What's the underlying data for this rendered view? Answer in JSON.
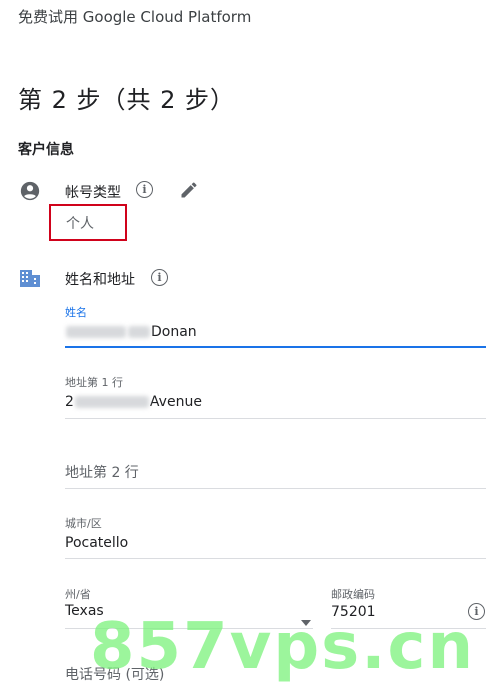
{
  "header": {
    "title": "免费试用 Google Cloud Platform"
  },
  "step": {
    "title": "第 2 步（共 2 步）"
  },
  "customer_info": {
    "title": "客户信息"
  },
  "account_type": {
    "label": "帐号类型",
    "value": "个人",
    "info_icon": "info-icon",
    "edit_icon": "pencil-icon"
  },
  "name_address": {
    "title": "姓名和地址",
    "info_icon": "info-icon",
    "section_icon": "building-icon"
  },
  "fields": {
    "name": {
      "label": "姓名",
      "value_suffix": "onan",
      "value_prefix_visible": "D"
    },
    "address1": {
      "label": "地址第 1 行",
      "value_prefix_visible": "2",
      "value_suffix": "Avenue"
    },
    "address2": {
      "placeholder": "地址第 2 行"
    },
    "city": {
      "label": "城市/区",
      "value": "Pocatello"
    },
    "state": {
      "label": "州/省",
      "value": "Texas",
      "dropdown_icon": "caret-down-icon"
    },
    "zip": {
      "label": "邮政编码",
      "value": "75201",
      "info_icon": "info-icon"
    },
    "phone": {
      "placeholder": "电话号码 (可选)"
    }
  },
  "watermark": {
    "text": "857vps.cn"
  },
  "colors": {
    "accent": "#1a73e8",
    "highlight_box": "#d0021b",
    "watermark": "#7cf27c"
  }
}
